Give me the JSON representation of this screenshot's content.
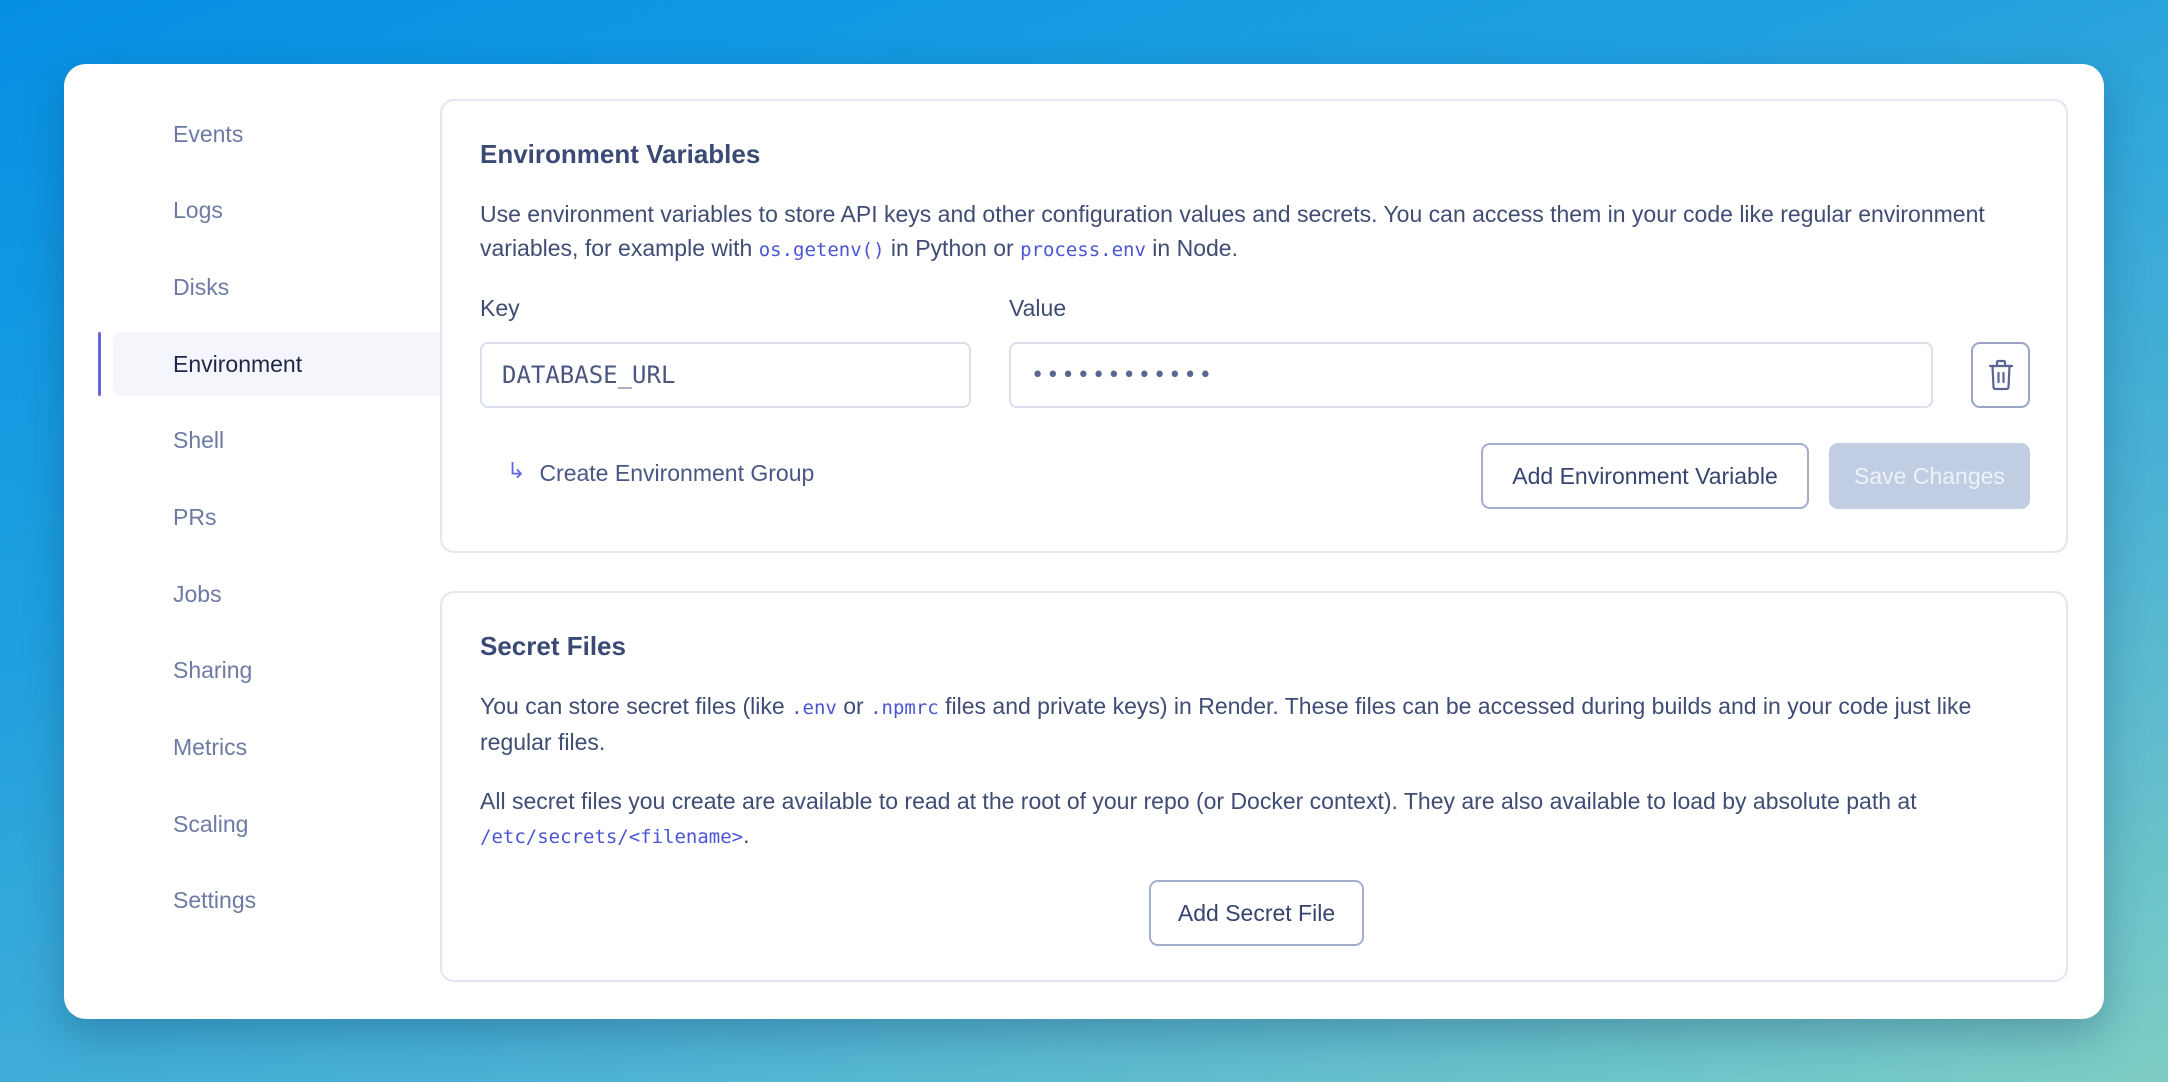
{
  "sidebar": {
    "items": [
      {
        "label": "Events",
        "active": false
      },
      {
        "label": "Logs",
        "active": false
      },
      {
        "label": "Disks",
        "active": false
      },
      {
        "label": "Environment",
        "active": true
      },
      {
        "label": "Shell",
        "active": false
      },
      {
        "label": "PRs",
        "active": false
      },
      {
        "label": "Jobs",
        "active": false
      },
      {
        "label": "Sharing",
        "active": false
      },
      {
        "label": "Metrics",
        "active": false
      },
      {
        "label": "Scaling",
        "active": false
      },
      {
        "label": "Settings",
        "active": false
      }
    ]
  },
  "env_section": {
    "title": "Environment Variables",
    "description_part1": "Use environment variables to store API keys and other configuration values and secrets. You can access them in your code like regular environment variables, for example with ",
    "code1": "os.getenv()",
    "description_part2": " in Python or ",
    "code2": "process.env",
    "description_part3": " in Node.",
    "key_label": "Key",
    "value_label": "Value",
    "rows": [
      {
        "key": "DATABASE_URL",
        "value_masked": "••••••••••••",
        "delete_icon": "trash-icon"
      }
    ],
    "create_group_icon": "arrow-return-right-icon",
    "create_group_label": "Create Environment Group",
    "add_button": "Add Environment Variable",
    "save_button": "Save Changes"
  },
  "secret_section": {
    "title": "Secret Files",
    "p1_part1": "You can store secret files (like ",
    "p1_code1": ".env",
    "p1_part2": " or ",
    "p1_code2": ".npmrc",
    "p1_part3": " files and private keys) in Render. These files can be accessed during builds and in your code just like regular files.",
    "p2_part1": "All secret files you create are available to read at the root of your repo (or Docker context). They are also available to load by absolute path at ",
    "p2_code": "/etc/secrets/<filename>",
    "p2_part2": ".",
    "add_button": "Add Secret File"
  },
  "colors": {
    "accent": "#6466e8",
    "code": "#4a55d4",
    "save_disabled_bg": "#c0cde3"
  }
}
